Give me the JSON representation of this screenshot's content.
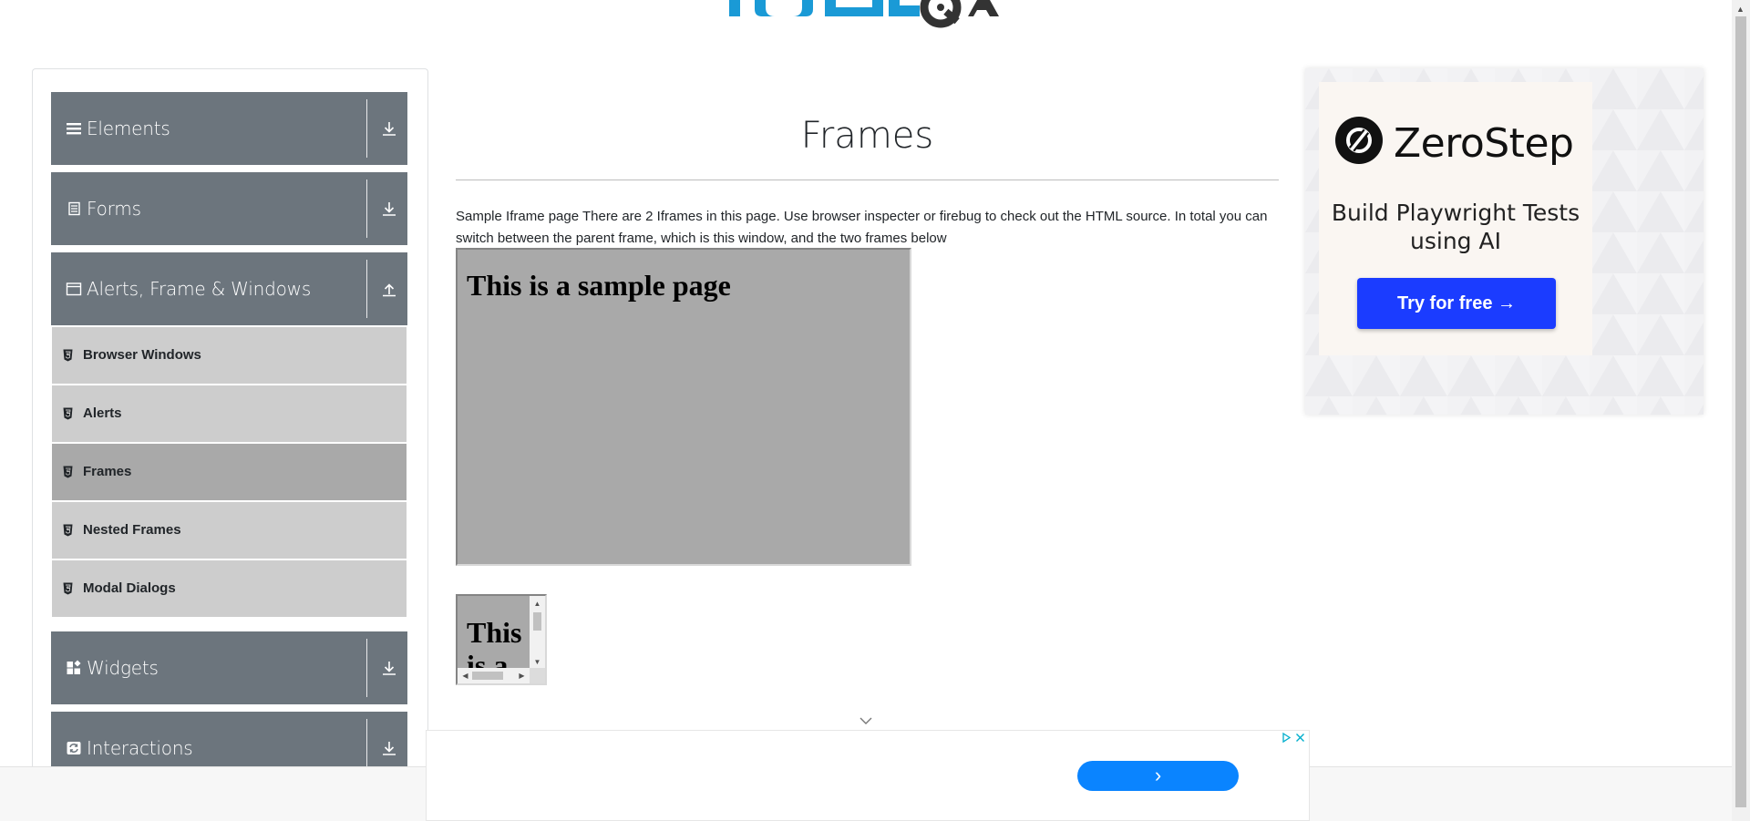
{
  "logo": {
    "icon": "toolsqa-logo"
  },
  "sidebar": {
    "groups": [
      {
        "label": "Elements",
        "icon": "hamburger-icon",
        "state": "collapsed"
      },
      {
        "label": "Forms",
        "icon": "document-icon",
        "state": "collapsed"
      },
      {
        "label": "Alerts, Frame & Windows",
        "icon": "window-icon",
        "state": "expanded"
      },
      {
        "label": "Widgets",
        "icon": "widgets-icon",
        "state": "collapsed"
      },
      {
        "label": "Interactions",
        "icon": "refresh-icon",
        "state": "collapsed"
      }
    ],
    "sub_items": [
      {
        "label": "Browser Windows",
        "active": false
      },
      {
        "label": "Alerts",
        "active": false
      },
      {
        "label": "Frames",
        "active": true
      },
      {
        "label": "Nested Frames",
        "active": false
      },
      {
        "label": "Modal Dialogs",
        "active": false
      }
    ]
  },
  "main": {
    "title": "Frames",
    "description": "Sample Iframe page There are 2 Iframes in this page. Use browser inspecter or firebug to check out the HTML source. In total you can switch between the parent frame, which is this window, and the two frames below",
    "frame1_heading": "This is a sample page",
    "frame2_heading": "This is a sample page"
  },
  "ad_right": {
    "brand": "ZeroStep",
    "tagline": "Build Playwright Tests using AI",
    "button_label": "Try for free →"
  },
  "ad_bottom": {
    "button_label": "›"
  },
  "colors": {
    "sidebar_header": "#6c757d",
    "sub_item": "#cdcdcd",
    "sub_item_active": "#a9a9a9",
    "frame_bg": "#a9a9a9",
    "zerostep_button": "#1b3cff",
    "ad_pill": "#0a84ff"
  }
}
